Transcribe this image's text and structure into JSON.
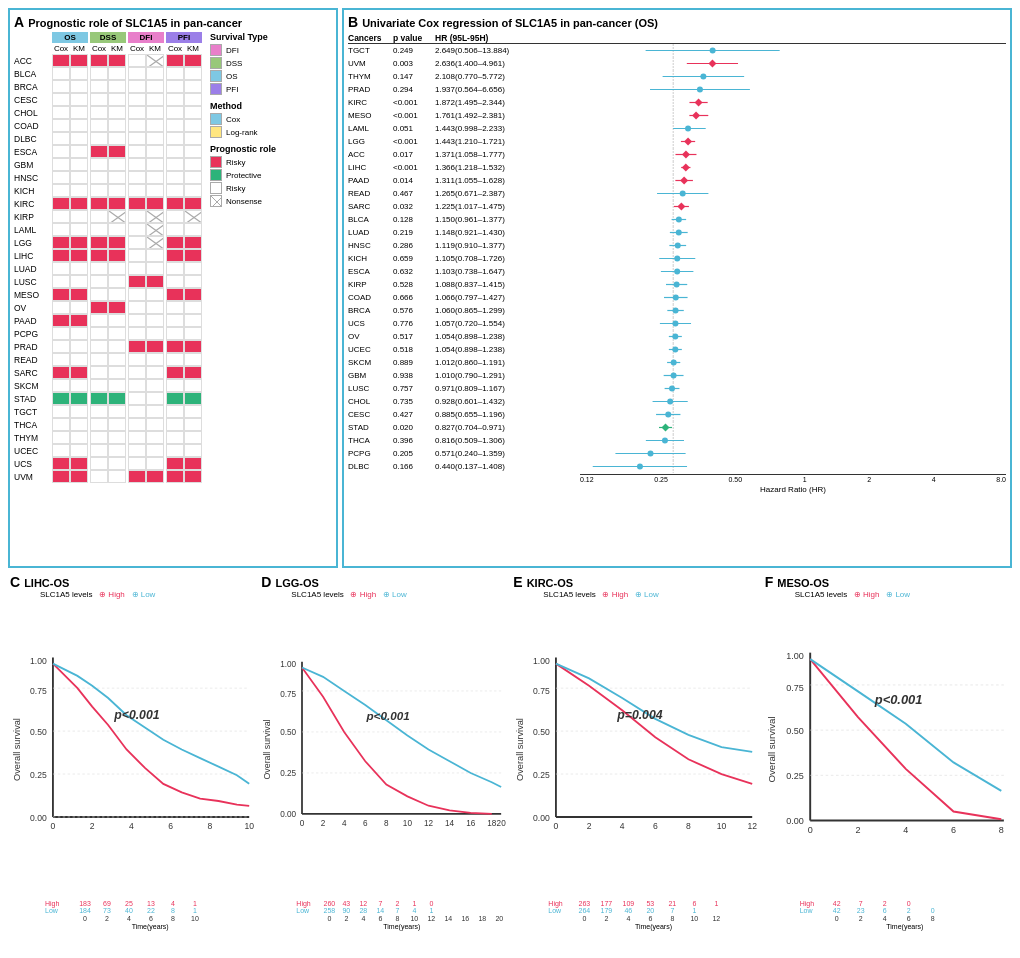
{
  "panelA": {
    "title": "Prognostic role of SLC1A5 in pan-cancer",
    "letter": "A",
    "groups": [
      "OS",
      "DSS",
      "DFI",
      "PFI"
    ],
    "subgroups": [
      "Cox",
      "KM"
    ],
    "cancers": [
      "ACC",
      "BLCA",
      "BRCA",
      "CESC",
      "CHOL",
      "COAD",
      "DLBC",
      "ESCA",
      "GBM",
      "HNSC",
      "KICH",
      "KIRC",
      "KIRP",
      "LAML",
      "LGG",
      "LIHC",
      "LUAD",
      "LUSC",
      "MESO",
      "OV",
      "PAAD",
      "PCPG",
      "PRAD",
      "READ",
      "SARC",
      "SKCM",
      "STAD",
      "TGCT",
      "THCA",
      "THYM",
      "UCEC",
      "UCS",
      "UVM"
    ],
    "legend": {
      "survival_types": [
        "DFI",
        "DSS",
        "OS",
        "PFI"
      ],
      "survival_colors": [
        "#e87fca",
        "#98c87a",
        "#7ec8e3",
        "#9b7fe8"
      ],
      "methods": [
        "Cox",
        "Log-rank"
      ],
      "method_colors": [
        "#7ec8e3",
        "#ffe680"
      ],
      "prognostic_roles": [
        "Risky",
        "Protective",
        "Risky",
        "Nonsense"
      ],
      "prognostic_colors": [
        "#e8325a",
        "#2db37a",
        "#ffffff",
        "#ffffff"
      ]
    }
  },
  "panelB": {
    "title": "Univariate Cox regression of SLC1A5 in pan-cancer (OS)",
    "letter": "B",
    "headers": [
      "Cancers",
      "p value",
      "HR (95L-95H)"
    ],
    "rows": [
      {
        "cancer": "TGCT",
        "pval": "0.249",
        "hr": "2.649(0.506–13.884)",
        "point": 0.82,
        "low": 0.4,
        "high": 0.98,
        "color": "#4ab5d4",
        "type": "dot"
      },
      {
        "cancer": "UVM",
        "pval": "0.003",
        "hr": "2.636(1.400–4.961)",
        "point": 0.79,
        "low": 0.62,
        "high": 0.9,
        "color": "#e8325a",
        "type": "diamond"
      },
      {
        "cancer": "THYM",
        "pval": "0.147",
        "hr": "2.108(0.770–5.772)",
        "point": 0.76,
        "low": 0.48,
        "high": 0.91,
        "color": "#4ab5d4",
        "type": "dot"
      },
      {
        "cancer": "PRAD",
        "pval": "0.294",
        "hr": "1.937(0.564–6.656)",
        "point": 0.74,
        "low": 0.44,
        "high": 0.9,
        "color": "#4ab5d4",
        "type": "dot"
      },
      {
        "cancer": "KIRC",
        "pval": "<0.001",
        "hr": "1.872(1.495–2.344)",
        "point": 0.73,
        "low": 0.66,
        "high": 0.8,
        "color": "#e8325a",
        "type": "diamond"
      },
      {
        "cancer": "MESO",
        "pval": "<0.001",
        "hr": "1.761(1.492–2.381)",
        "point": 0.71,
        "low": 0.64,
        "high": 0.79,
        "color": "#e8325a",
        "type": "diamond"
      },
      {
        "cancer": "LAML",
        "pval": "0.051",
        "hr": "1.443(0.998–2.233)",
        "point": 0.68,
        "low": 0.58,
        "high": 0.76,
        "color": "#4ab5d4",
        "type": "dot"
      },
      {
        "cancer": "LGG",
        "pval": "<0.001",
        "hr": "1.443(1.210–1.721)",
        "point": 0.68,
        "low": 0.64,
        "high": 0.73,
        "color": "#e8325a",
        "type": "diamond"
      },
      {
        "cancer": "ACC",
        "pval": "0.017",
        "hr": "1.371(1.058–1.777)",
        "point": 0.66,
        "low": 0.61,
        "high": 0.72,
        "color": "#e8325a",
        "type": "diamond"
      },
      {
        "cancer": "LIHC",
        "pval": "<0.001",
        "hr": "1.366(1.218–1.532)",
        "point": 0.66,
        "low": 0.62,
        "high": 0.7,
        "color": "#e8325a",
        "type": "diamond"
      },
      {
        "cancer": "PAAD",
        "pval": "0.014",
        "hr": "1.311(1.055–1.628)",
        "point": 0.65,
        "low": 0.61,
        "high": 0.69,
        "color": "#e8325a",
        "type": "diamond"
      },
      {
        "cancer": "READ",
        "pval": "0.467",
        "hr": "1.265(0.671–2.387)",
        "point": 0.64,
        "low": 0.52,
        "high": 0.75,
        "color": "#4ab5d4",
        "type": "dot"
      },
      {
        "cancer": "SARC",
        "pval": "0.032",
        "hr": "1.225(1.017–1.475)",
        "point": 0.63,
        "low": 0.6,
        "high": 0.67,
        "color": "#e8325a",
        "type": "diamond"
      },
      {
        "cancer": "BLCA",
        "pval": "0.128",
        "hr": "1.150(0.961–1.377)",
        "point": 0.62,
        "low": 0.59,
        "high": 0.65,
        "color": "#4ab5d4",
        "type": "dot"
      },
      {
        "cancer": "LUAD",
        "pval": "0.219",
        "hr": "1.148(0.921–1.430)",
        "point": 0.62,
        "low": 0.59,
        "high": 0.65,
        "color": "#4ab5d4",
        "type": "dot"
      },
      {
        "cancer": "HNSC",
        "pval": "0.286",
        "hr": "1.119(0.910–1.377)",
        "point": 0.61,
        "low": 0.58,
        "high": 0.65,
        "color": "#4ab5d4",
        "type": "dot"
      },
      {
        "cancer": "KICH",
        "pval": "0.659",
        "hr": "1.105(0.708–1.726)",
        "point": 0.61,
        "low": 0.55,
        "high": 0.67,
        "color": "#4ab5d4",
        "type": "dot"
      },
      {
        "cancer": "ESCA",
        "pval": "0.632",
        "hr": "1.103(0.738–1.647)",
        "point": 0.61,
        "low": 0.55,
        "high": 0.67,
        "color": "#4ab5d4",
        "type": "dot"
      },
      {
        "cancer": "KIRP",
        "pval": "0.528",
        "hr": "1.088(0.837–1.415)",
        "point": 0.61,
        "low": 0.57,
        "high": 0.65,
        "color": "#4ab5d4",
        "type": "dot"
      },
      {
        "cancer": "COAD",
        "pval": "0.666",
        "hr": "1.066(0.797–1.427)",
        "point": 0.6,
        "low": 0.56,
        "high": 0.65,
        "color": "#4ab5d4",
        "type": "dot"
      },
      {
        "cancer": "BRCA",
        "pval": "0.576",
        "hr": "1.060(0.865–1.299)",
        "point": 0.6,
        "low": 0.57,
        "high": 0.64,
        "color": "#4ab5d4",
        "type": "dot"
      },
      {
        "cancer": "UCS",
        "pval": "0.776",
        "hr": "1.057(0.720–1.554)",
        "point": 0.6,
        "low": 0.55,
        "high": 0.65,
        "color": "#4ab5d4",
        "type": "dot"
      },
      {
        "cancer": "OV",
        "pval": "0.517",
        "hr": "1.054(0.898–1.238)",
        "point": 0.6,
        "low": 0.57,
        "high": 0.63,
        "color": "#4ab5d4",
        "type": "dot"
      },
      {
        "cancer": "UCEC",
        "pval": "0.518",
        "hr": "1.054(0.898–1.238)",
        "point": 0.6,
        "low": 0.57,
        "high": 0.63,
        "color": "#4ab5d4",
        "type": "dot"
      },
      {
        "cancer": "SKCM",
        "pval": "0.889",
        "hr": "1.012(0.860–1.191)",
        "point": 0.59,
        "low": 0.57,
        "high": 0.62,
        "color": "#4ab5d4",
        "type": "dot"
      },
      {
        "cancer": "GBM",
        "pval": "0.938",
        "hr": "1.010(0.790–1.291)",
        "point": 0.59,
        "low": 0.56,
        "high": 0.62,
        "color": "#4ab5d4",
        "type": "dot"
      },
      {
        "cancer": "LUSC",
        "pval": "0.757",
        "hr": "0.971(0.809–1.167)",
        "point": 0.58,
        "low": 0.56,
        "high": 0.61,
        "color": "#4ab5d4",
        "type": "dot"
      },
      {
        "cancer": "CHOL",
        "pval": "0.735",
        "hr": "0.928(0.601–1.432)",
        "point": 0.57,
        "low": 0.52,
        "high": 0.63,
        "color": "#4ab5d4",
        "type": "dot"
      },
      {
        "cancer": "CESC",
        "pval": "0.427",
        "hr": "0.885(0.655–1.196)",
        "point": 0.56,
        "low": 0.52,
        "high": 0.61,
        "color": "#4ab5d4",
        "type": "dot"
      },
      {
        "cancer": "STAD",
        "pval": "0.020",
        "hr": "0.827(0.704–0.971)",
        "point": 0.55,
        "low": 0.52,
        "high": 0.58,
        "color": "#2db37a",
        "type": "diamond"
      },
      {
        "cancer": "THCA",
        "pval": "0.396",
        "hr": "0.816(0.509–1.306)",
        "point": 0.54,
        "low": 0.48,
        "high": 0.61,
        "color": "#4ab5d4",
        "type": "dot"
      },
      {
        "cancer": "PCPG",
        "pval": "0.205",
        "hr": "0.571(0.240–1.359)",
        "point": 0.5,
        "low": 0.4,
        "high": 0.62,
        "color": "#4ab5d4",
        "type": "dot"
      },
      {
        "cancer": "DLBC",
        "pval": "0.166",
        "hr": "0.440(0.137–1.408)",
        "point": 0.46,
        "low": 0.32,
        "high": 0.64,
        "color": "#4ab5d4",
        "type": "dot"
      }
    ],
    "axis_labels": [
      "0.12",
      "0.25",
      "0.50",
      "1",
      "2",
      "4",
      "8.0"
    ],
    "x_label": "Hazard Ratio (HR)"
  },
  "panelC": {
    "letter": "C",
    "title": "LIHC-OS",
    "subtitle": "SLC1A5 levels",
    "pval": "p<0.001",
    "high_color": "#e8325a",
    "low_color": "#4ab5d4",
    "x_label": "Time(years)",
    "y_label": "Overall survival",
    "x_max": 10,
    "risk_table": {
      "timepoints": [
        0,
        2,
        4,
        6,
        8,
        10
      ],
      "high": [
        183,
        69,
        25,
        13,
        4,
        1
      ],
      "low": [
        184,
        73,
        40,
        22,
        8,
        1
      ]
    }
  },
  "panelD": {
    "letter": "D",
    "title": "LGG-OS",
    "subtitle": "SLC1A5 levels",
    "pval": "p<0.001",
    "high_color": "#e8325a",
    "low_color": "#4ab5d4",
    "x_label": "Time(years)",
    "y_label": "Overall survival",
    "x_max": 20,
    "risk_table": {
      "timepoints": [
        0,
        2,
        4,
        6,
        8,
        10,
        12,
        14,
        16,
        18,
        20
      ],
      "high": [
        260,
        43,
        12,
        7,
        2,
        1,
        0,
        null,
        null,
        null,
        null
      ],
      "low": [
        258,
        90,
        28,
        14,
        7,
        4,
        1,
        null,
        null,
        null,
        null
      ]
    }
  },
  "panelE": {
    "letter": "E",
    "title": "KIRC-OS",
    "subtitle": "SLC1A5 levels",
    "pval": "p=0.004",
    "high_color": "#e8325a",
    "low_color": "#4ab5d4",
    "x_label": "Time(years)",
    "y_label": "Overall survival",
    "x_max": 12,
    "risk_table": {
      "timepoints": [
        0,
        2,
        4,
        6,
        8,
        10,
        12
      ],
      "high": [
        263,
        177,
        109,
        53,
        21,
        6,
        1
      ],
      "low": [
        264,
        179,
        46,
        20,
        7,
        1,
        null
      ]
    }
  },
  "panelF": {
    "letter": "F",
    "title": "MESO-OS",
    "subtitle": "SLC1A5 levels",
    "pval": "p<0.001",
    "high_color": "#e8325a",
    "low_color": "#4ab5d4",
    "x_label": "Time(years)",
    "y_label": "Overall survival",
    "x_max": 8,
    "risk_table": {
      "timepoints": [
        0,
        2,
        4,
        6,
        8
      ],
      "high": [
        42,
        7,
        2,
        0,
        null
      ],
      "low": [
        42,
        23,
        6,
        2,
        0
      ]
    }
  }
}
